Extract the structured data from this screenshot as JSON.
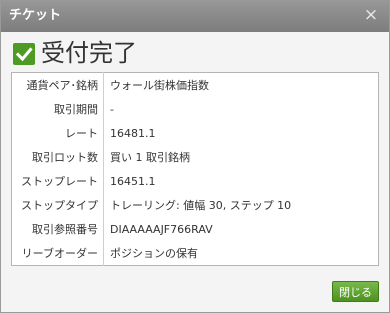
{
  "dialog": {
    "title": "チケット",
    "close_glyph": "×",
    "headline": "受付完了",
    "close_button_label": "閉じる"
  },
  "details": [
    {
      "label": "通貨ペア･銘柄",
      "value": "ウォール街株価指数"
    },
    {
      "label": "取引期間",
      "value": "-"
    },
    {
      "label": "レート",
      "value": "16481.1"
    },
    {
      "label": "取引ロット数",
      "value": "買い 1 取引銘柄"
    },
    {
      "label": "ストップレート",
      "value": "16451.1"
    },
    {
      "label": "ストップタイプ",
      "value": "トレーリング: 値幅 30, ステップ 10"
    },
    {
      "label": "取引参照番号",
      "value": "DIAAAAAJF766RAV"
    },
    {
      "label": "リーブオーダー",
      "value": "ポジションの保有"
    }
  ],
  "colors": {
    "titlebar": "#8a8a8a",
    "accent_green": "#4f9a24",
    "body_background": "#f4f4f4"
  },
  "icons": {
    "headline_icon": "check-icon",
    "close_icon": "close-icon"
  }
}
